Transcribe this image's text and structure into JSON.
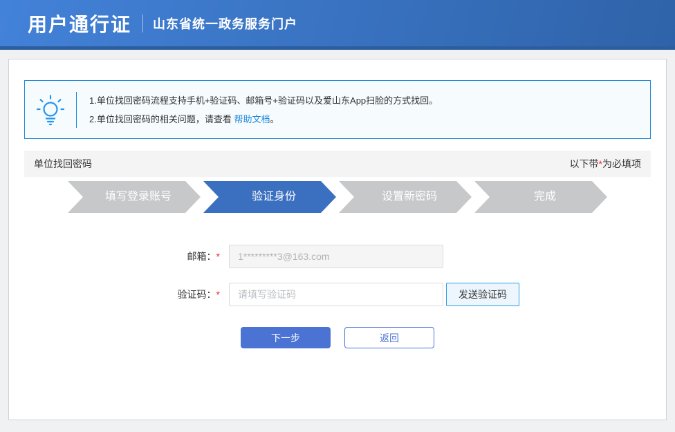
{
  "header": {
    "title": "用户通行证",
    "subtitle": "山东省统一政务服务门户"
  },
  "tips": {
    "line1": "1.单位找回密码流程支持手机+验证码、邮箱号+验证码以及爱山东App扫脸的方式找回。",
    "line2_prefix": "2.单位找回密码的相关问题，请查看 ",
    "line2_link": "帮助文档",
    "line2_suffix": "。",
    "icon": "lightbulb-icon"
  },
  "section": {
    "title": "单位找回密码",
    "required_note_prefix": "以下带",
    "required_star": "*",
    "required_note_suffix": "为必填项"
  },
  "wizard": {
    "steps": [
      {
        "label": "填写登录账号",
        "active": false
      },
      {
        "label": "验证身份",
        "active": true
      },
      {
        "label": "设置新密码",
        "active": false
      },
      {
        "label": "完成",
        "active": false
      }
    ]
  },
  "form": {
    "email": {
      "label": "邮箱：",
      "required": "*",
      "value": "1*********3@163.com",
      "disabled": true
    },
    "code": {
      "label": "验证码：",
      "required": "*",
      "placeholder": "请填写验证码",
      "send_button_label": "发送验证码"
    }
  },
  "actions": {
    "next_label": "下一步",
    "back_label": "返回"
  },
  "colors": {
    "header_gradient_start": "#4382d9",
    "header_gradient_end": "#2f63a9",
    "header_bottom_strip": "#2c5d9e",
    "tip_border": "#1e87d8",
    "tip_background": "#f6fbfe",
    "link": "#1e87d8",
    "step_inactive": "#c6c8ca",
    "step_active": "#3b70c1",
    "primary_button": "#4a73d4",
    "send_button_border": "#2e9ce4",
    "send_button_background": "#edf6fd",
    "required_star": "#f5222d",
    "page_background": "#f0f1f2"
  }
}
